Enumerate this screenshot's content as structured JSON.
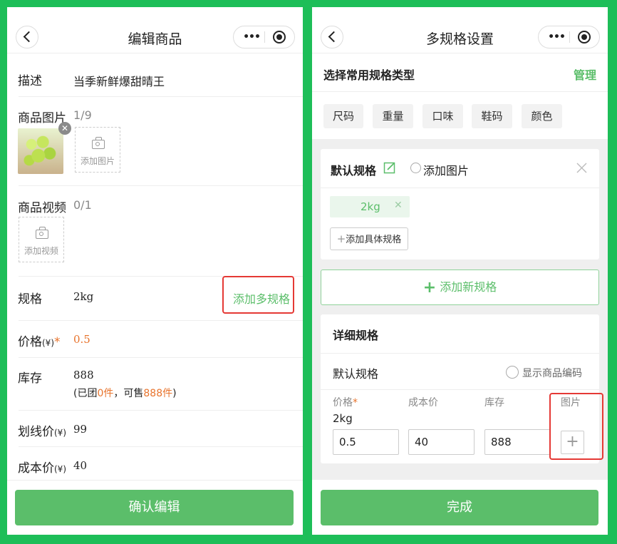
{
  "left": {
    "nav_title": "编辑商品",
    "description": {
      "label": "描述",
      "value": "当季新鲜爆甜晴王"
    },
    "images": {
      "label": "商品图片",
      "count": "1/9",
      "add_label": "添加图片"
    },
    "video": {
      "label": "商品视频",
      "count": "0/1",
      "add_label": "添加视频"
    },
    "spec": {
      "label": "规格",
      "value": "2kg",
      "add_multi": "添加多规格"
    },
    "price": {
      "label": "价格",
      "unit": "(¥)",
      "required": "*",
      "value": "0.5"
    },
    "stock": {
      "label": "库存",
      "value": "888",
      "note_prefix": "(已团",
      "grouped": "0件",
      "note_mid": "，可售",
      "available": "888件",
      "note_suffix": ")"
    },
    "strike_price": {
      "label": "划线价",
      "unit": "(¥)",
      "value": "99"
    },
    "cost_price": {
      "label": "成本价",
      "unit": "(¥)",
      "value": "40"
    },
    "confirm_button": "确认编辑"
  },
  "right": {
    "nav_title": "多规格设置",
    "common_types": {
      "title": "选择常用规格类型",
      "manage": "管理",
      "chips": [
        "尺码",
        "重量",
        "口味",
        "鞋码",
        "颜色"
      ]
    },
    "default_spec": {
      "title": "默认规格",
      "add_image": "添加图片",
      "tag": "2kg",
      "add_specific": "添加具体规格"
    },
    "add_new_spec": "添加新规格",
    "detail": {
      "title": "详细规格",
      "row_name": "默认规格",
      "show_code": "显示商品编码",
      "headers": {
        "price": "价格",
        "required": "*",
        "cost": "成本价",
        "stock": "库存",
        "image": "图片"
      },
      "spec_value": "2kg",
      "price": "0.5",
      "cost": "40",
      "stock": "888"
    },
    "done_button": "完成"
  },
  "colors": {
    "accent_green": "#5bbe6a",
    "highlight_red": "#e53935",
    "orange": "#e8742d",
    "frame_green": "#1dbe58"
  }
}
